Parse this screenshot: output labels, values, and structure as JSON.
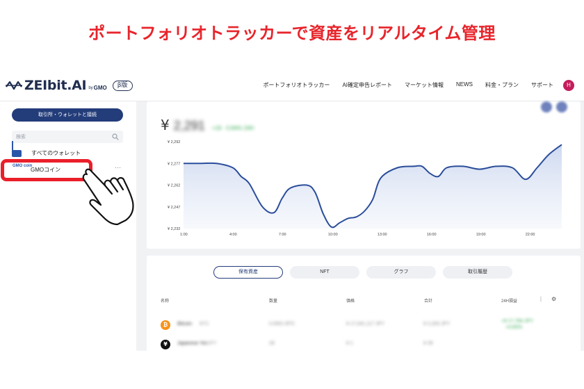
{
  "headline": "ポートフォリオトラッカーで資産をリアルタイム管理",
  "header": {
    "logo_text": "ZEIbit.AI",
    "logo_by": "by",
    "logo_gmo": "GMO",
    "beta_label": "β版",
    "nav": [
      "ポートフォリオトラッカー",
      "AI確定申告レポート",
      "マーケット情報",
      "NEWS",
      "料金・プラン",
      "サポート"
    ],
    "avatar_initial": "H",
    "accent_color": "#233c7a",
    "avatar_color": "#c41d5c"
  },
  "sidebar": {
    "connect_button": "取引所・ウォレットと接続",
    "search_placeholder": "検索",
    "all_wallets": "すべてのウォレット",
    "selected_wallet": "GMOコイン",
    "selected_wallet_logo": "GMO coin",
    "more": "…",
    "highlight_color": "#ea1f2a"
  },
  "summary": {
    "currency": "¥",
    "value": "2,291",
    "change": "+19 · 0.84%  24H"
  },
  "chart_data": {
    "type": "area",
    "x_ticks": [
      "1:00",
      "4:00",
      "7:00",
      "10:00",
      "13:00",
      "16:00",
      "19:00",
      "22:00"
    ],
    "y_ticks": [
      "¥ 2,292",
      "¥ 2,277",
      "¥ 2,262",
      "¥ 2,247",
      "¥ 2,232"
    ],
    "ylim": [
      2232,
      2292
    ],
    "x": [
      1,
      2,
      3,
      4,
      4.5,
      5,
      5.8,
      6.5,
      7,
      7.5,
      8.5,
      9,
      9.5,
      10,
      10.5,
      11,
      11.5,
      12,
      12.5,
      13,
      14,
      15,
      15.5,
      16,
      16.5,
      17,
      18,
      19,
      20,
      21,
      21.8,
      22.5,
      23.2,
      24
    ],
    "values": [
      2277,
      2277,
      2277,
      2274,
      2268,
      2263,
      2247,
      2243,
      2253,
      2260,
      2262,
      2257,
      2242,
      2233,
      2236,
      2239,
      2240,
      2244,
      2252,
      2267,
      2274,
      2275,
      2275,
      2270,
      2268,
      2274,
      2275,
      2273,
      2275,
      2274,
      2266,
      2274,
      2283,
      2290
    ],
    "line_color": "#2a4d9a",
    "grid": false
  },
  "holdings": {
    "tabs": [
      "保有資産",
      "NFT",
      "グラフ",
      "取引履歴"
    ],
    "columns": [
      "名称",
      "数量",
      "価格",
      "合計",
      "24H損益"
    ],
    "menu_icon": "⋮",
    "filter_icon": "⚙",
    "rows": [
      {
        "icon": "₿",
        "icon_color": "#f7931a",
        "name": "Bitcoin",
        "ticker": "BTC",
        "qty": "0.0001 BTC",
        "price": "¥ 17,041,117 JPY",
        "total": "¥ 2,263 JPY",
        "pnl": "+¥ 17,784 JPY",
        "pnl2": "+0.85%"
      },
      {
        "icon": "¥",
        "icon_color": "#111111",
        "name": "Japanese Yen",
        "ticker": "JPY",
        "qty": "28",
        "price": "¥ 1",
        "total": "¥ 28",
        "pnl": "",
        "pnl2": ""
      }
    ]
  }
}
